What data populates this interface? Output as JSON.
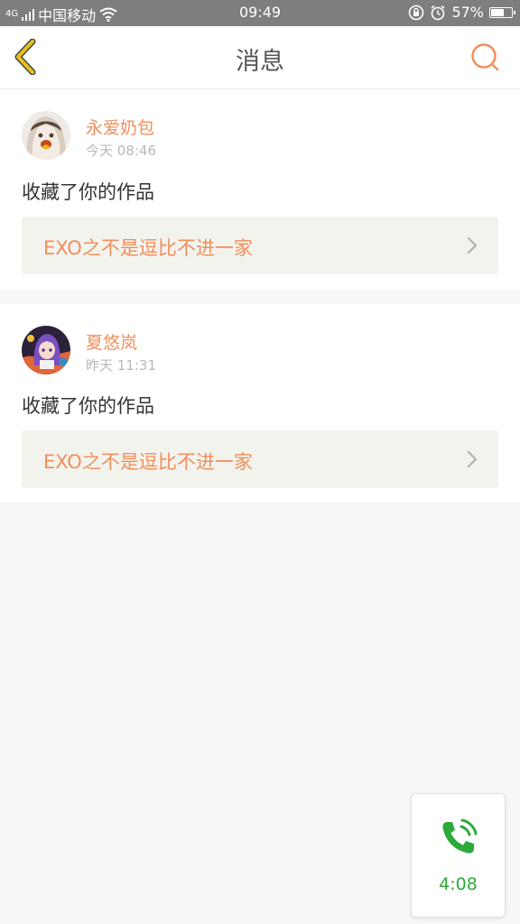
{
  "status_bar": {
    "carrier": "中国移动",
    "signal_tag": "4G",
    "time": "09:49",
    "battery": "57%",
    "battery_level": 0.57
  },
  "header": {
    "title": "消息",
    "back_icon": "chevron-left-icon",
    "search_icon": "search-icon"
  },
  "messages": [
    {
      "username": "永爱奶包",
      "time": "今天 08:46",
      "action": "收藏了你的作品",
      "work_title": "EXO之不是逗比不进一家"
    },
    {
      "username": "夏悠岚",
      "time": "昨天 11:31",
      "action": "收藏了你的作品",
      "work_title": "EXO之不是逗比不进一家"
    }
  ],
  "call_widget": {
    "icon": "phone-call-icon",
    "duration": "4:08"
  },
  "colors": {
    "accent": "#f08f5b",
    "back_icon": "#e8c11a",
    "call_green": "#2eaa3a",
    "status_bar": "#7e7e7e"
  }
}
